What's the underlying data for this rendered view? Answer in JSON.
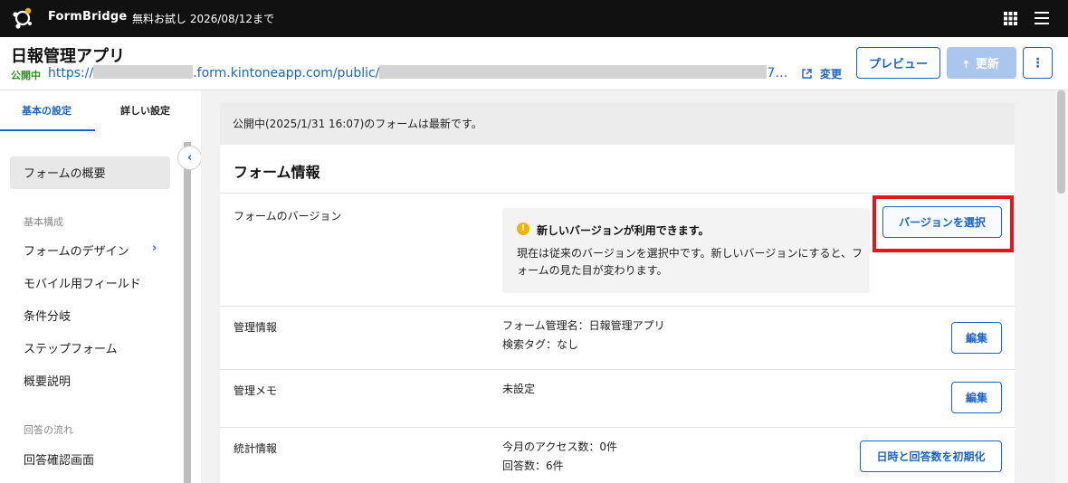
{
  "topbar": {
    "brand": "FormBridge",
    "trial": "無料お試し 2026/08/12まで",
    "icons": [
      "formbridge-logo-icon",
      "apps-grid-icon",
      "hamburger-menu-icon"
    ]
  },
  "header": {
    "title": "日報管理アプリ",
    "status": "公開中",
    "url_prefix": "https://",
    "url_middle": ".form.kintoneapp.com/public/",
    "url_tail": "7…",
    "change_label": "変更",
    "preview_label": "プレビュー",
    "update_label": "更新",
    "more_label": "⋮"
  },
  "sidebar": {
    "tabs": [
      {
        "label": "基本の設定",
        "active": true
      },
      {
        "label": "詳しい設定",
        "active": false
      }
    ],
    "items": [
      {
        "label": "フォームの概要",
        "active": true
      },
      {
        "section": "基本構成"
      },
      {
        "label": "フォームのデザイン",
        "has_chevron": true
      },
      {
        "label": "モバイル用フィールド"
      },
      {
        "label": "条件分岐"
      },
      {
        "label": "ステップフォーム"
      },
      {
        "label": "概要説明"
      },
      {
        "section": "回答の流れ"
      },
      {
        "label": "回答確認画面"
      }
    ]
  },
  "main": {
    "notice": "公開中(2025/1/31 16:07)のフォームは最新です。",
    "section_title": "フォーム情報",
    "version": {
      "label": "フォームのバージョン",
      "alert_title": "新しいバージョンが利用できます。",
      "alert_body": "現在は従来のバージョンを選択中です。新しいバージョンにすると、フォームの見た目が変わります。",
      "button": "バージョンを選択"
    },
    "admin": {
      "label": "管理情報",
      "line1": "フォーム管理名：日報管理アプリ",
      "line2": "検索タグ：なし",
      "button": "編集"
    },
    "memo": {
      "label": "管理メモ",
      "value": "未設定",
      "button": "編集"
    },
    "stats": {
      "label": "統計情報",
      "line1": "今月のアクセス数：0件",
      "line2": "回答数：6件",
      "button": "日時と回答数を初期化"
    }
  },
  "colors": {
    "accent": "#1a64c8",
    "status_green": "#2e8b21",
    "highlight_red": "#e8141b",
    "warning": "#f0b400"
  }
}
